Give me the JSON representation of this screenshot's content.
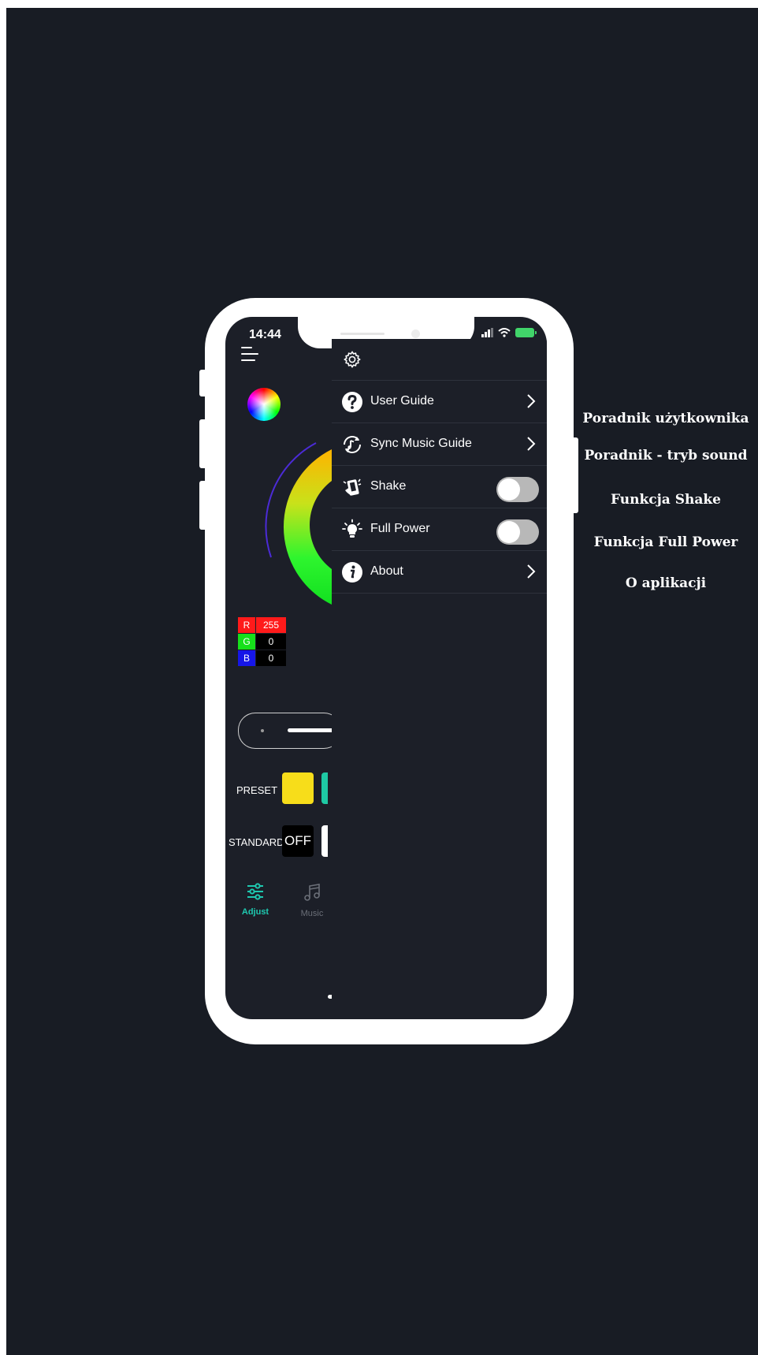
{
  "status_bar": {
    "time": "14:44"
  },
  "app": {
    "rgb": [
      {
        "key": "R",
        "value": "255",
        "color": "#ff1a1a",
        "value_bg": "#ff1a1a"
      },
      {
        "key": "G",
        "value": "0",
        "color": "#16e01b",
        "value_bg": "#000000"
      },
      {
        "key": "B",
        "value": "0",
        "color": "#1616e8",
        "value_bg": "#000000"
      }
    ],
    "preset_label": "PRESET",
    "standard_label": "STANDARD",
    "off_label": "OFF",
    "tabs": [
      {
        "label": "Adjust",
        "icon": "sliders-icon",
        "active": true,
        "color": "#1ec9b0"
      },
      {
        "label": "Music",
        "icon": "music-note-icon",
        "active": false,
        "color": "#6b6f78"
      }
    ]
  },
  "drawer": {
    "settings_icon": "gear-icon",
    "items": [
      {
        "label": "User Guide",
        "icon": "question-icon",
        "control": "chevron"
      },
      {
        "label": "Sync Music Guide",
        "icon": "sync-music-icon",
        "control": "chevron"
      },
      {
        "label": "Shake",
        "icon": "shake-icon",
        "control": "toggle",
        "on": false
      },
      {
        "label": "Full Power",
        "icon": "lightbulb-icon",
        "control": "toggle",
        "on": false
      },
      {
        "label": "About",
        "icon": "info-icon",
        "control": "chevron"
      }
    ]
  },
  "annotations": [
    "Poradnik użytkownika",
    "Poradnik - tryb sound",
    "Funkcja Shake",
    "Funkcja Full Power",
    "O aplikacji"
  ],
  "colors": {
    "background": "#181c24",
    "screen": "#1c1f28",
    "accent": "#1ec9b0",
    "preset_swatch": "#f7dd1a"
  }
}
